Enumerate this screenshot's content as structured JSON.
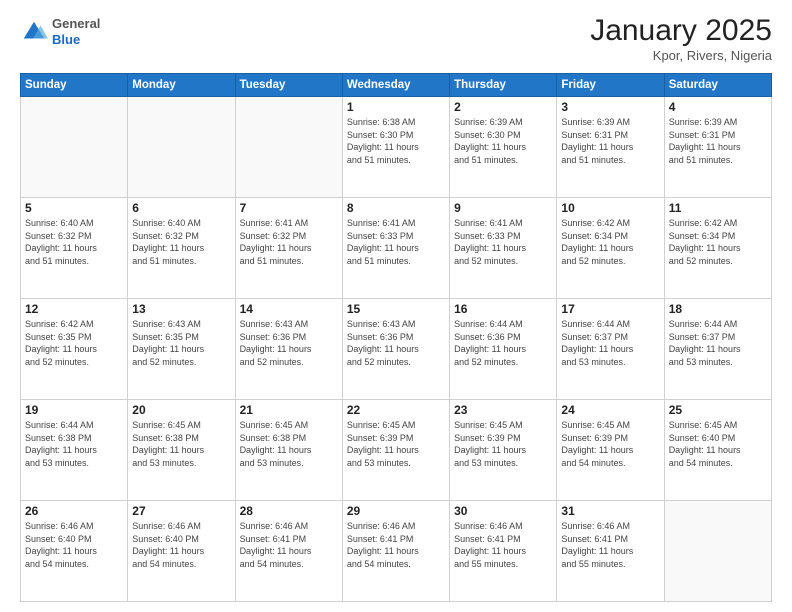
{
  "header": {
    "logo_line1": "General",
    "logo_line2": "Blue",
    "title": "January 2025",
    "subtitle": "Kpor, Rivers, Nigeria"
  },
  "weekdays": [
    "Sunday",
    "Monday",
    "Tuesday",
    "Wednesday",
    "Thursday",
    "Friday",
    "Saturday"
  ],
  "weeks": [
    [
      {
        "day": "",
        "info": ""
      },
      {
        "day": "",
        "info": ""
      },
      {
        "day": "",
        "info": ""
      },
      {
        "day": "1",
        "info": "Sunrise: 6:38 AM\nSunset: 6:30 PM\nDaylight: 11 hours\nand 51 minutes."
      },
      {
        "day": "2",
        "info": "Sunrise: 6:39 AM\nSunset: 6:30 PM\nDaylight: 11 hours\nand 51 minutes."
      },
      {
        "day": "3",
        "info": "Sunrise: 6:39 AM\nSunset: 6:31 PM\nDaylight: 11 hours\nand 51 minutes."
      },
      {
        "day": "4",
        "info": "Sunrise: 6:39 AM\nSunset: 6:31 PM\nDaylight: 11 hours\nand 51 minutes."
      }
    ],
    [
      {
        "day": "5",
        "info": "Sunrise: 6:40 AM\nSunset: 6:32 PM\nDaylight: 11 hours\nand 51 minutes."
      },
      {
        "day": "6",
        "info": "Sunrise: 6:40 AM\nSunset: 6:32 PM\nDaylight: 11 hours\nand 51 minutes."
      },
      {
        "day": "7",
        "info": "Sunrise: 6:41 AM\nSunset: 6:32 PM\nDaylight: 11 hours\nand 51 minutes."
      },
      {
        "day": "8",
        "info": "Sunrise: 6:41 AM\nSunset: 6:33 PM\nDaylight: 11 hours\nand 51 minutes."
      },
      {
        "day": "9",
        "info": "Sunrise: 6:41 AM\nSunset: 6:33 PM\nDaylight: 11 hours\nand 52 minutes."
      },
      {
        "day": "10",
        "info": "Sunrise: 6:42 AM\nSunset: 6:34 PM\nDaylight: 11 hours\nand 52 minutes."
      },
      {
        "day": "11",
        "info": "Sunrise: 6:42 AM\nSunset: 6:34 PM\nDaylight: 11 hours\nand 52 minutes."
      }
    ],
    [
      {
        "day": "12",
        "info": "Sunrise: 6:42 AM\nSunset: 6:35 PM\nDaylight: 11 hours\nand 52 minutes."
      },
      {
        "day": "13",
        "info": "Sunrise: 6:43 AM\nSunset: 6:35 PM\nDaylight: 11 hours\nand 52 minutes."
      },
      {
        "day": "14",
        "info": "Sunrise: 6:43 AM\nSunset: 6:36 PM\nDaylight: 11 hours\nand 52 minutes."
      },
      {
        "day": "15",
        "info": "Sunrise: 6:43 AM\nSunset: 6:36 PM\nDaylight: 11 hours\nand 52 minutes."
      },
      {
        "day": "16",
        "info": "Sunrise: 6:44 AM\nSunset: 6:36 PM\nDaylight: 11 hours\nand 52 minutes."
      },
      {
        "day": "17",
        "info": "Sunrise: 6:44 AM\nSunset: 6:37 PM\nDaylight: 11 hours\nand 53 minutes."
      },
      {
        "day": "18",
        "info": "Sunrise: 6:44 AM\nSunset: 6:37 PM\nDaylight: 11 hours\nand 53 minutes."
      }
    ],
    [
      {
        "day": "19",
        "info": "Sunrise: 6:44 AM\nSunset: 6:38 PM\nDaylight: 11 hours\nand 53 minutes."
      },
      {
        "day": "20",
        "info": "Sunrise: 6:45 AM\nSunset: 6:38 PM\nDaylight: 11 hours\nand 53 minutes."
      },
      {
        "day": "21",
        "info": "Sunrise: 6:45 AM\nSunset: 6:38 PM\nDaylight: 11 hours\nand 53 minutes."
      },
      {
        "day": "22",
        "info": "Sunrise: 6:45 AM\nSunset: 6:39 PM\nDaylight: 11 hours\nand 53 minutes."
      },
      {
        "day": "23",
        "info": "Sunrise: 6:45 AM\nSunset: 6:39 PM\nDaylight: 11 hours\nand 53 minutes."
      },
      {
        "day": "24",
        "info": "Sunrise: 6:45 AM\nSunset: 6:39 PM\nDaylight: 11 hours\nand 54 minutes."
      },
      {
        "day": "25",
        "info": "Sunrise: 6:45 AM\nSunset: 6:40 PM\nDaylight: 11 hours\nand 54 minutes."
      }
    ],
    [
      {
        "day": "26",
        "info": "Sunrise: 6:46 AM\nSunset: 6:40 PM\nDaylight: 11 hours\nand 54 minutes."
      },
      {
        "day": "27",
        "info": "Sunrise: 6:46 AM\nSunset: 6:40 PM\nDaylight: 11 hours\nand 54 minutes."
      },
      {
        "day": "28",
        "info": "Sunrise: 6:46 AM\nSunset: 6:41 PM\nDaylight: 11 hours\nand 54 minutes."
      },
      {
        "day": "29",
        "info": "Sunrise: 6:46 AM\nSunset: 6:41 PM\nDaylight: 11 hours\nand 54 minutes."
      },
      {
        "day": "30",
        "info": "Sunrise: 6:46 AM\nSunset: 6:41 PM\nDaylight: 11 hours\nand 55 minutes."
      },
      {
        "day": "31",
        "info": "Sunrise: 6:46 AM\nSunset: 6:41 PM\nDaylight: 11 hours\nand 55 minutes."
      },
      {
        "day": "",
        "info": ""
      }
    ]
  ]
}
